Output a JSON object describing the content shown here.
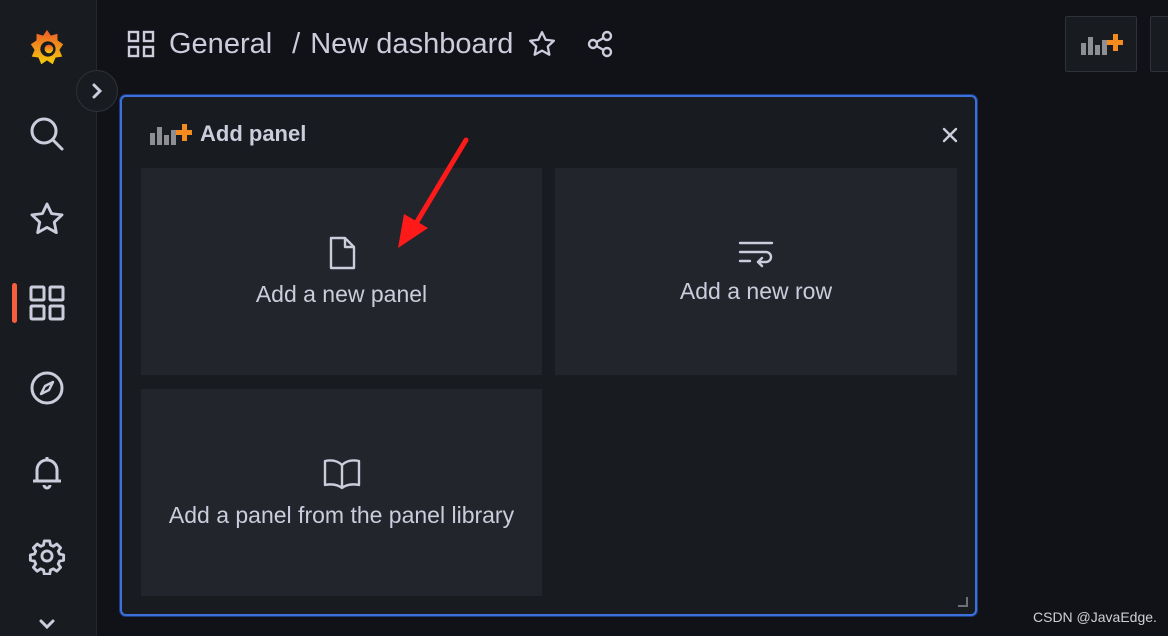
{
  "sidebar": {
    "items": [
      {
        "name": "grafana-logo",
        "icon": "grafana-logo-icon"
      },
      {
        "name": "search",
        "icon": "search-icon"
      },
      {
        "name": "starred",
        "icon": "star-icon"
      },
      {
        "name": "dashboards",
        "icon": "apps-grid-icon",
        "active": true
      },
      {
        "name": "explore",
        "icon": "compass-icon"
      },
      {
        "name": "alerting",
        "icon": "bell-icon"
      },
      {
        "name": "configuration",
        "icon": "gear-icon"
      },
      {
        "name": "more",
        "icon": "chevron-down-icon"
      }
    ]
  },
  "breadcrumb": {
    "folder": "General",
    "separator": "/",
    "dashboard": "New dashboard"
  },
  "modal": {
    "title": "Add panel",
    "options": [
      {
        "label": "Add a new panel",
        "icon": "file-icon"
      },
      {
        "label": "Add a new row",
        "icon": "wrap-text-icon"
      },
      {
        "label": "Add a panel from the panel library",
        "icon": "book-open-icon"
      }
    ]
  },
  "colors": {
    "accent": "#3d71d9",
    "active_bar": "#f55f3e",
    "brand": "#f58a1f",
    "annotation_arrow": "#ff1a1a"
  },
  "watermark": "CSDN @JavaEdge."
}
